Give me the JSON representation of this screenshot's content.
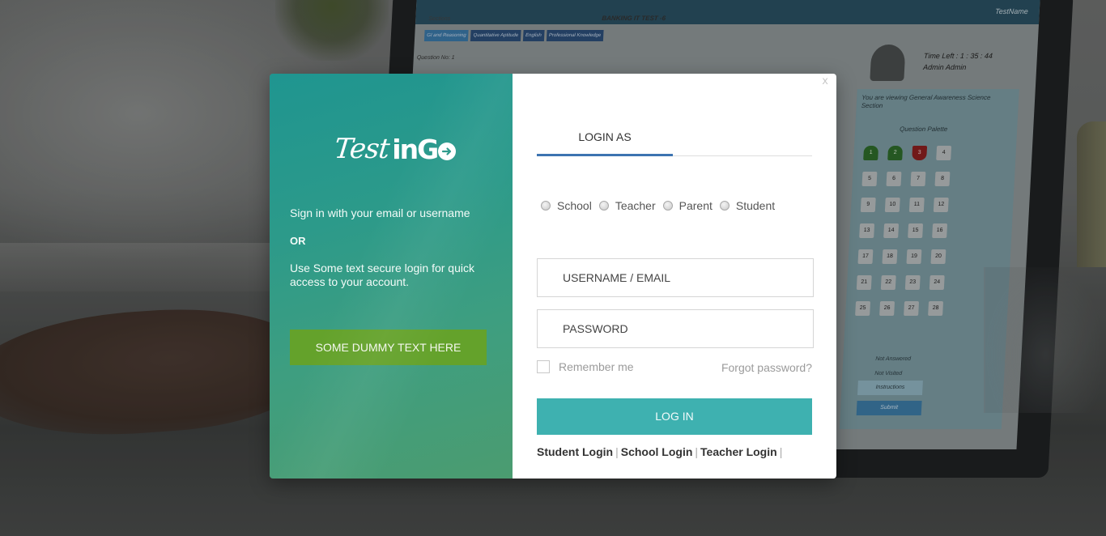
{
  "background": {
    "exam_title": "BANKING IT TEST -6",
    "topbar_right": "TestName",
    "sections_label": "Sections",
    "section_tabs": [
      "GI and Reasoning",
      "Quantitative Aptitude",
      "English",
      "Professional Knowledge"
    ],
    "question_no": "Question No: 1",
    "time_left": "Time Left : 1 : 35 : 44",
    "user_name": "Admin Admin",
    "viewing_text": "You are viewing General Awareness Science Section",
    "palette_title": "Question Palette",
    "palette_cells": [
      {
        "n": "1",
        "state": "answered"
      },
      {
        "n": "2",
        "state": "answered"
      },
      {
        "n": "3",
        "state": "not-answered"
      },
      {
        "n": "4",
        "state": "not-visited"
      },
      {
        "n": "5",
        "state": "not-visited"
      },
      {
        "n": "6",
        "state": "not-visited"
      },
      {
        "n": "7",
        "state": "not-visited"
      },
      {
        "n": "8",
        "state": "not-visited"
      },
      {
        "n": "9",
        "state": "not-visited"
      },
      {
        "n": "10",
        "state": "not-visited"
      },
      {
        "n": "11",
        "state": "not-visited"
      },
      {
        "n": "12",
        "state": "not-visited"
      },
      {
        "n": "13",
        "state": "not-visited"
      },
      {
        "n": "14",
        "state": "not-visited"
      },
      {
        "n": "15",
        "state": "not-visited"
      },
      {
        "n": "16",
        "state": "not-visited"
      },
      {
        "n": "17",
        "state": "not-visited"
      },
      {
        "n": "18",
        "state": "not-visited"
      },
      {
        "n": "19",
        "state": "not-visited"
      },
      {
        "n": "20",
        "state": "not-visited"
      },
      {
        "n": "21",
        "state": "not-visited"
      },
      {
        "n": "22",
        "state": "not-visited"
      },
      {
        "n": "23",
        "state": "not-visited"
      },
      {
        "n": "24",
        "state": "not-visited"
      },
      {
        "n": "25",
        "state": "not-visited"
      },
      {
        "n": "26",
        "state": "not-visited"
      },
      {
        "n": "27",
        "state": "not-visited"
      },
      {
        "n": "28",
        "state": "not-visited"
      }
    ],
    "legend_not_answered": "Not Answered",
    "legend_not_visited": "Not Visited",
    "instructions_label": "Instructions",
    "submit_label": "Submit"
  },
  "modal": {
    "close_label": "x",
    "left": {
      "logo_script": "Test",
      "logo_bold": "inG",
      "sign_in_text": "Sign in with your email or username",
      "or_text": "OR",
      "secure_text": "Use Some text secure login for quick access to your account.",
      "dummy_button": "SOME DUMMY TEXT HERE"
    },
    "right": {
      "tab_label": "LOGIN AS",
      "roles": [
        "School",
        "Teacher",
        "Parent",
        "Student"
      ],
      "username_placeholder": "USERNAME / EMAIL",
      "password_placeholder": "PASSWORD",
      "remember_label": "Remember me",
      "forgot_label": "Forgot password?",
      "login_button": "LOG IN",
      "quick_links": [
        "Student Login",
        "School Login",
        "Teacher Login"
      ],
      "separator": "|"
    }
  },
  "colors": {
    "login_button": "#3eb1b0",
    "dummy_button": "#64a22b",
    "tab_underline": "#3d74b1",
    "panel_gradient_start": "#1f9590",
    "panel_gradient_end": "#4b9c70"
  }
}
